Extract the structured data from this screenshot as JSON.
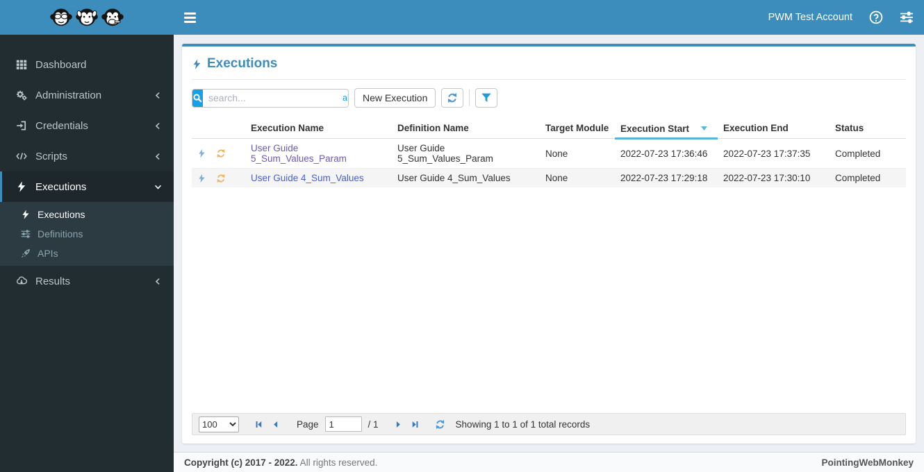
{
  "header": {
    "account": "PWM Test Account"
  },
  "sidebar": {
    "items": [
      {
        "label": "Dashboard"
      },
      {
        "label": "Administration"
      },
      {
        "label": "Credentials"
      },
      {
        "label": "Scripts"
      },
      {
        "label": "Executions"
      },
      {
        "label": "Results"
      }
    ],
    "submenu": [
      {
        "label": "Executions"
      },
      {
        "label": "Definitions"
      },
      {
        "label": "APIs"
      }
    ]
  },
  "panel": {
    "title": "Executions",
    "toolbar": {
      "search_placeholder": "search...",
      "search_scope": "all",
      "new_execution_label": "New Execution"
    },
    "table": {
      "columns": [
        "Execution Name",
        "Definition Name",
        "Target Module",
        "Execution Start",
        "Execution End",
        "Status"
      ],
      "sorted_column": "Execution Start",
      "sort_direction": "descending",
      "rows": [
        {
          "execution_name": "User Guide 5_Sum_Values_Param",
          "definition_name": "User Guide 5_Sum_Values_Param",
          "target_module": "None",
          "execution_start": "2022-07-23 17:36:46",
          "execution_end": "2022-07-23 17:37:35",
          "status": "Completed"
        },
        {
          "execution_name": "User Guide 4_Sum_Values",
          "definition_name": "User Guide 4_Sum_Values",
          "target_module": "None",
          "execution_start": "2022-07-23 17:29:18",
          "execution_end": "2022-07-23 17:30:10",
          "status": "Completed"
        }
      ]
    },
    "pagination": {
      "page_size": "100",
      "page_label": "Page",
      "current_page": "1",
      "total_pages_label": "/ 1",
      "summary": "Showing 1 to 1 of 1 total records"
    }
  },
  "footer": {
    "copyright_bold": "Copyright (c) 2017 - 2022.",
    "copyright_rest": " All rights reserved.",
    "brand": "PointingWebMonkey"
  },
  "colors": {
    "header_bg": "#3c8dbc",
    "sidebar_bg": "#222d32",
    "sidebar_active_bg": "#1e282c",
    "submenu_bg": "#2c3b41",
    "accent": "#3c8dbc",
    "search_button": "#18a0e4",
    "sort_indicator": "#56b5d8",
    "row_bolt_icon": "#79aede",
    "row_sync_icon": "#f0b35e",
    "link_visited": "#6a58b5",
    "link": "#4a5fc8",
    "content_bg": "#ecf0f5"
  }
}
